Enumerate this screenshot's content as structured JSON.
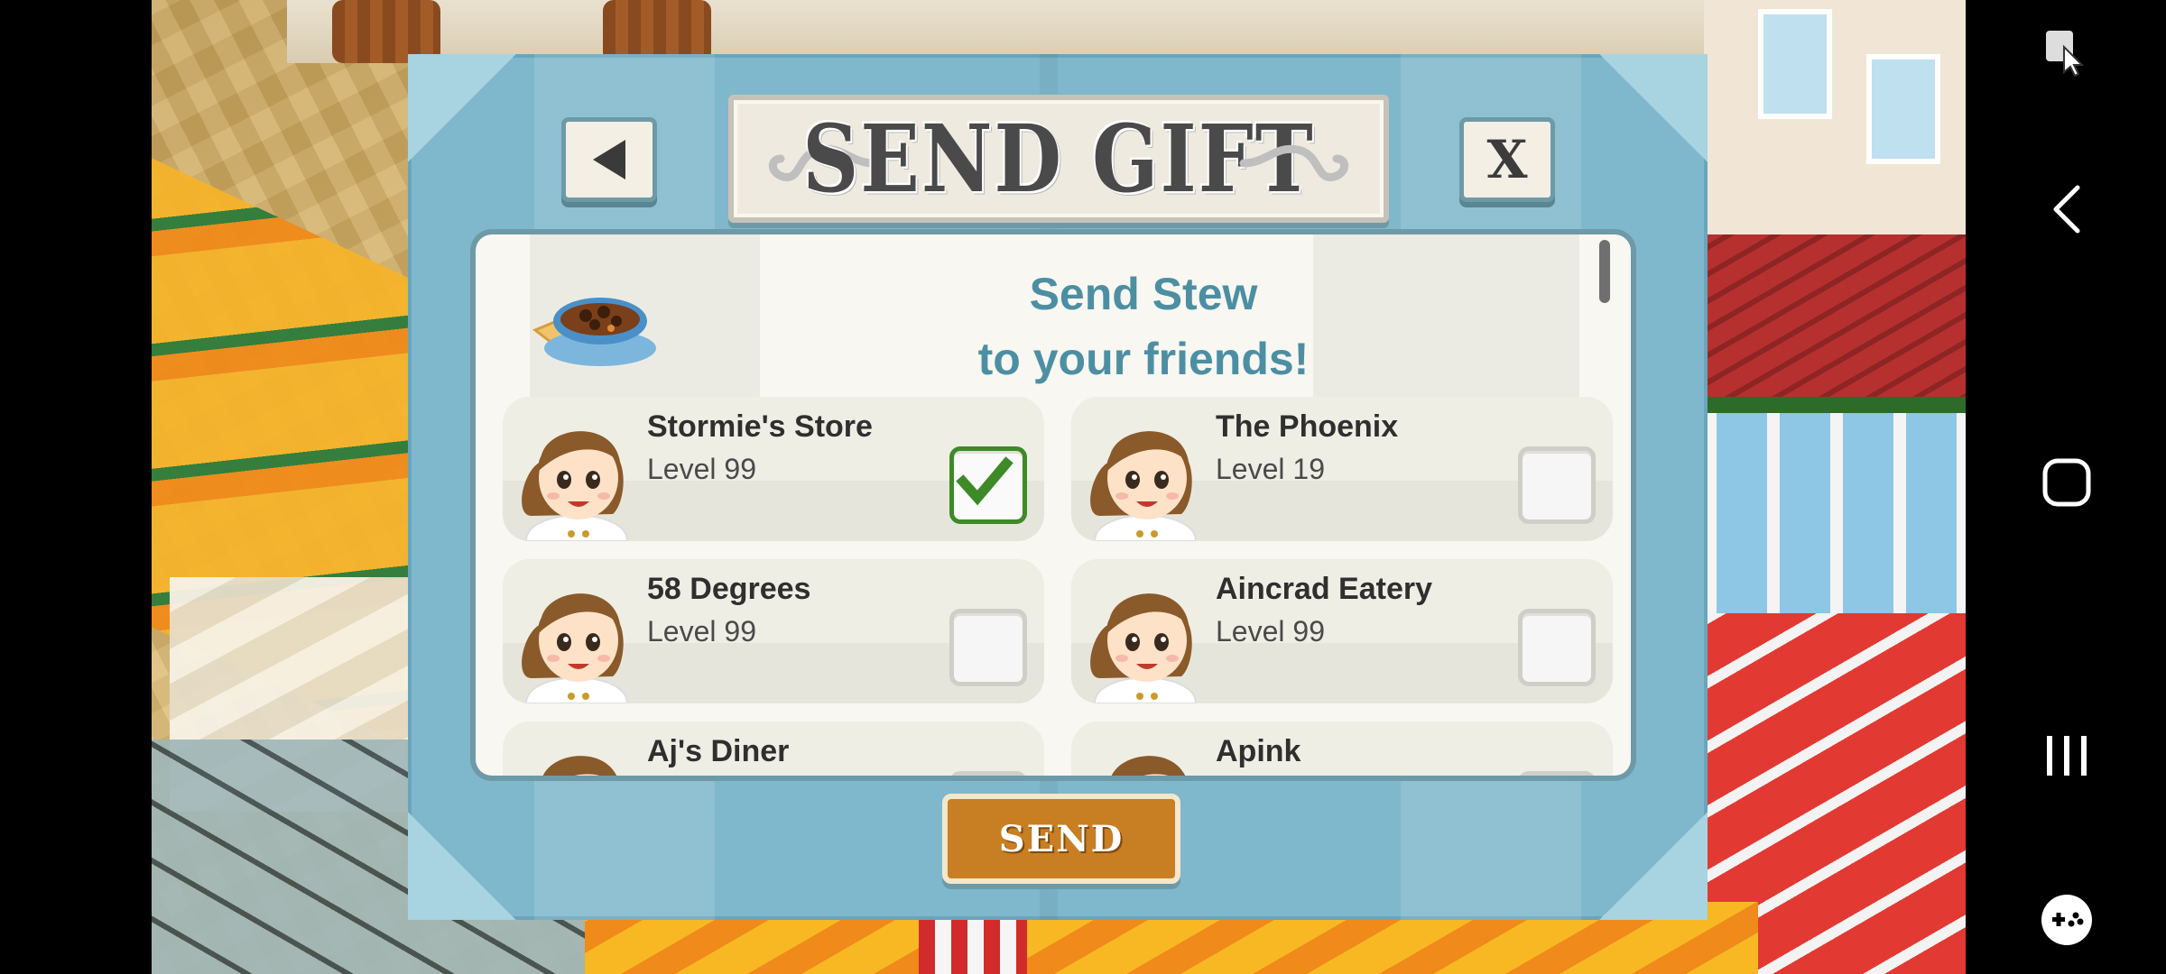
{
  "dialog": {
    "title": "SEND GIFT",
    "headline_line1": "Send Stew",
    "headline_line2": "to your friends!",
    "send_label": "SEND",
    "close_label": "X",
    "gift_item_icon": "stew-bowl-icon"
  },
  "friends": [
    {
      "name": "Stormie's Store",
      "level": "Level 99",
      "checked": true
    },
    {
      "name": "The Phoenix",
      "level": "Level 19",
      "checked": false
    },
    {
      "name": "58 Degrees",
      "level": "Level 99",
      "checked": false
    },
    {
      "name": "Aincrad Eatery",
      "level": "Level 99",
      "checked": false
    },
    {
      "name": "Aj's Diner",
      "level": "",
      "checked": false
    },
    {
      "name": "Apink",
      "level": "",
      "checked": false
    }
  ],
  "nav": {
    "icons": [
      "pointer-tool-icon",
      "back-icon",
      "home-icon",
      "recent-apps-icon",
      "game-tools-icon"
    ]
  },
  "colors": {
    "dialog_bg": "#7fb8cc",
    "headline": "#4c8fa3",
    "send_button": "#c87e22",
    "checkbox_check": "#3d8a27"
  }
}
